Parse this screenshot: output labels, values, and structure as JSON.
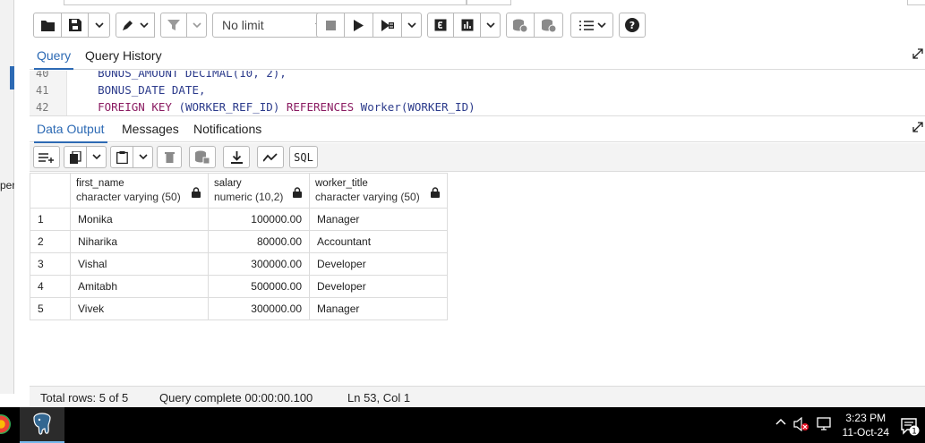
{
  "toolbar": {
    "limit_label": "No limit"
  },
  "query_tabs": [
    {
      "label": "Query",
      "active": true
    },
    {
      "label": "Query History",
      "active": false
    }
  ],
  "editor": {
    "lines": [
      {
        "no": "40",
        "code": "    BONUS_AMOUNT DECIMAL(10, 2),"
      },
      {
        "no": "41",
        "code": "    BONUS_DATE DATE,"
      },
      {
        "no": "42",
        "code": "    FOREIGN KEY (WORKER_REF_ID) REFERENCES Worker(WORKER_ID)"
      }
    ]
  },
  "output_tabs": [
    {
      "label": "Data Output",
      "active": true
    },
    {
      "label": "Messages",
      "active": false
    },
    {
      "label": "Notifications",
      "active": false
    }
  ],
  "output_toolbar": {
    "sql_label": "SQL"
  },
  "grid": {
    "columns": [
      {
        "name": "first_name",
        "type": "character varying (50)"
      },
      {
        "name": "salary",
        "type": "numeric (10,2)"
      },
      {
        "name": "worker_title",
        "type": "character varying (50)"
      }
    ],
    "rows": [
      {
        "n": "1",
        "first_name": "Monika",
        "salary": "100000.00",
        "worker_title": "Manager"
      },
      {
        "n": "2",
        "first_name": "Niharika",
        "salary": "80000.00",
        "worker_title": "Accountant"
      },
      {
        "n": "3",
        "first_name": "Vishal",
        "salary": "300000.00",
        "worker_title": "Developer"
      },
      {
        "n": "4",
        "first_name": "Amitabh",
        "salary": "500000.00",
        "worker_title": "Developer"
      },
      {
        "n": "5",
        "first_name": "Vivek",
        "salary": "300000.00",
        "worker_title": "Manager"
      }
    ]
  },
  "status": {
    "total_rows": "Total rows: 5 of 5",
    "query_complete": "Query complete 00:00:00.100",
    "cursor": "Ln 53, Col 1"
  },
  "left_strip": {
    "cut_text": "per"
  },
  "taskbar": {
    "time": "3:23 PM",
    "date": "11-Oct-24",
    "notification_count": "1"
  },
  "colors": {
    "accent": "#2d6ab4",
    "keyword": "#8b1c62",
    "identifier": "#2d3c8c"
  }
}
